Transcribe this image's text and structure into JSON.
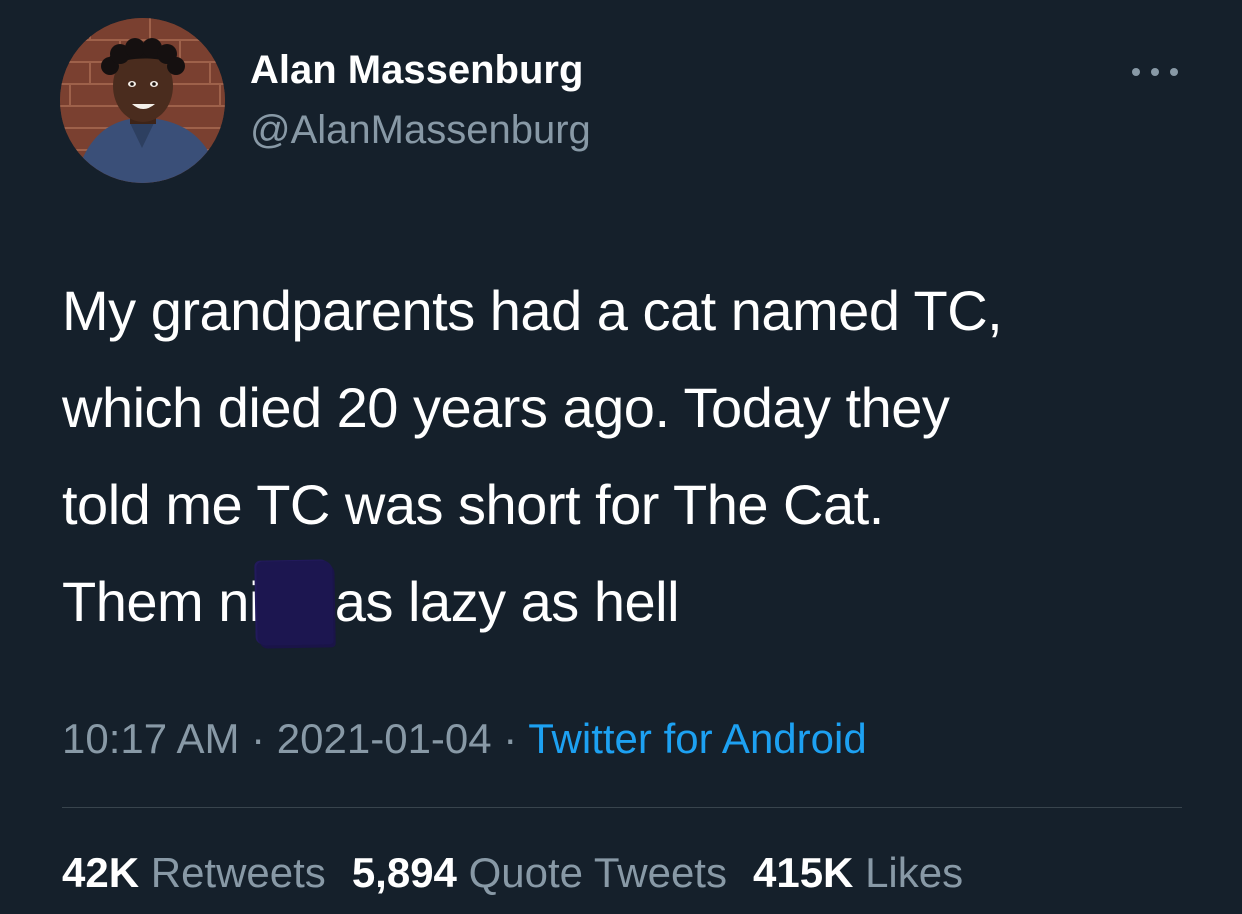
{
  "user": {
    "display_name": "Alan Massenburg",
    "handle": "@AlanMassenburg",
    "avatar_icon": "profile-photo"
  },
  "tweet": {
    "lines": [
      "My grandparents had a cat named TC,",
      "which died 20 years ago. Today they",
      "told me TC was short for The Cat.",
      "Them ni",
      "as lazy as hell"
    ]
  },
  "meta": {
    "time": "10:17 AM",
    "sep1": " · ",
    "date": "2021-01-04",
    "sep2": " · ",
    "source": "Twitter for Android"
  },
  "stats": {
    "retweets_count": "42K",
    "retweets_label": "Retweets",
    "quotes_count": "5,894",
    "quotes_label": "Quote Tweets",
    "likes_count": "415K",
    "likes_label": "Likes"
  },
  "colors": {
    "background": "#15202b",
    "text": "#ffffff",
    "secondary": "#8899a6",
    "link": "#1da1f2",
    "divider": "#38444d"
  },
  "icons": {
    "more": "more-horizontal-icon"
  }
}
